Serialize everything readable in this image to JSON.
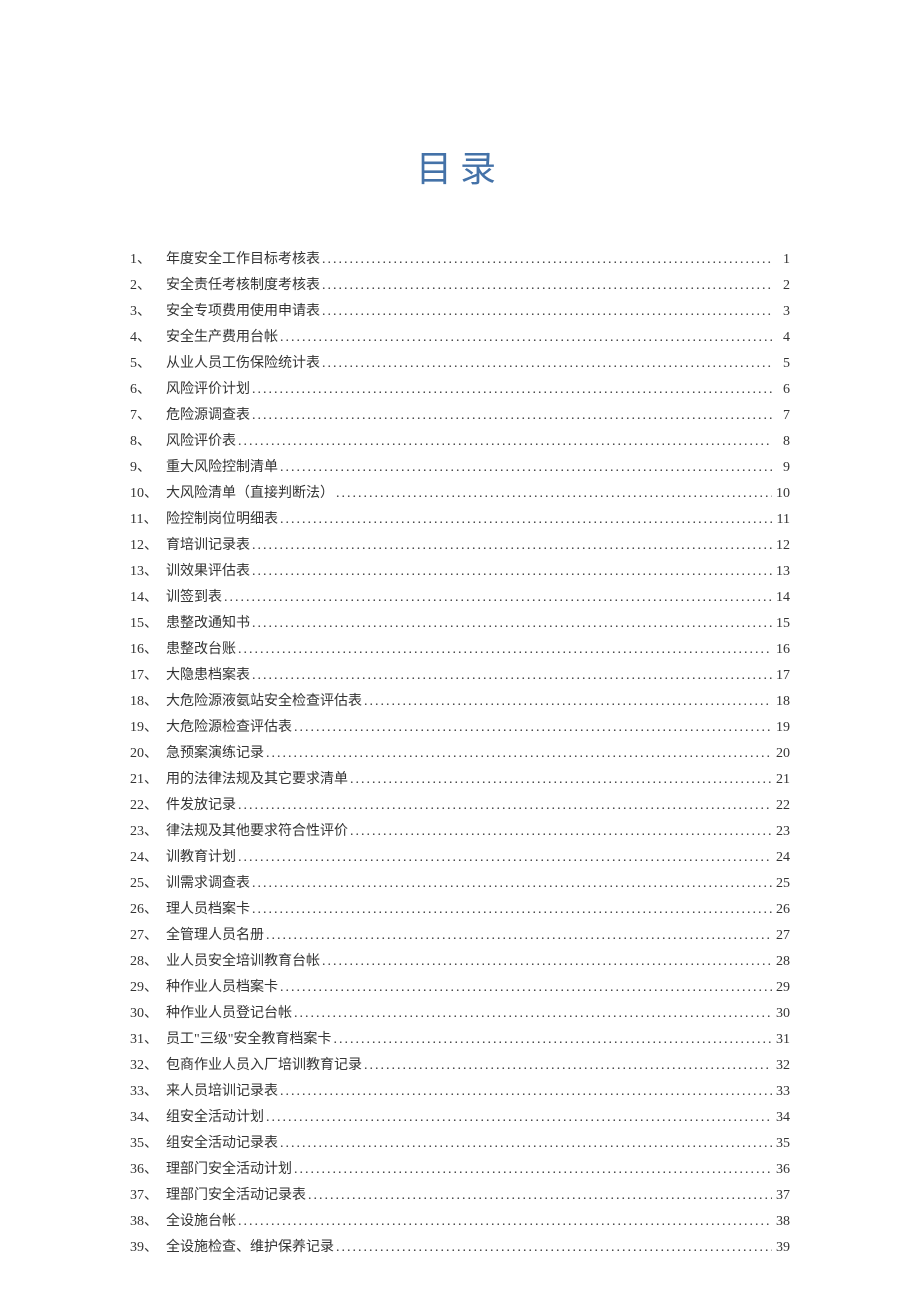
{
  "title": "目录",
  "toc": [
    {
      "num": "1、",
      "label": "年度安全工作目标考核表",
      "page": "1"
    },
    {
      "num": "2、",
      "label": "安全责任考核制度考核表",
      "page": "2"
    },
    {
      "num": "3、",
      "label": "安全专项费用使用申请表",
      "page": "3"
    },
    {
      "num": "4、",
      "label": "安全生产费用台帐",
      "page": "4"
    },
    {
      "num": "5、",
      "label": "从业人员工伤保险统计表",
      "page": "5"
    },
    {
      "num": "6、",
      "label": "风险评价计划",
      "page": "6"
    },
    {
      "num": "7、",
      "label": "危险源调查表",
      "page": "7"
    },
    {
      "num": "8、",
      "label": "风险评价表",
      "page": "8"
    },
    {
      "num": "9、",
      "label": "重大风险控制清单",
      "page": "9"
    },
    {
      "num": "10、",
      "label": "大风险清单（直接判断法）",
      "page": "10"
    },
    {
      "num": "11、",
      "label": "险控制岗位明细表",
      "page": "11"
    },
    {
      "num": "12、",
      "label": "育培训记录表",
      "page": "12"
    },
    {
      "num": "13、",
      "label": "训效果评估表",
      "page": "13"
    },
    {
      "num": "14、",
      "label": "训签到表",
      "page": "14"
    },
    {
      "num": "15、",
      "label": "患整改通知书",
      "page": "15"
    },
    {
      "num": "16、",
      "label": "患整改台账",
      "page": "16"
    },
    {
      "num": "17、",
      "label": "大隐患档案表",
      "page": "17"
    },
    {
      "num": "18、",
      "label": "大危险源液氨站安全检查评估表",
      "page": "18"
    },
    {
      "num": "19、",
      "label": "大危险源检查评估表",
      "page": "19"
    },
    {
      "num": "20、",
      "label": "急预案演练记录",
      "page": "20"
    },
    {
      "num": "21、",
      "label": "用的法律法规及其它要求清单",
      "page": "21"
    },
    {
      "num": "22、",
      "label": "件发放记录",
      "page": "22"
    },
    {
      "num": "23、",
      "label": "律法规及其他要求符合性评价",
      "page": "23"
    },
    {
      "num": "24、",
      "label": "训教育计划",
      "page": "24"
    },
    {
      "num": "25、",
      "label": "训需求调查表",
      "page": "25"
    },
    {
      "num": "26、",
      "label": "理人员档案卡",
      "page": "26"
    },
    {
      "num": "27、",
      "label": "全管理人员名册",
      "page": "27"
    },
    {
      "num": "28、",
      "label": "业人员安全培训教育台帐",
      "page": "28"
    },
    {
      "num": "29、",
      "label": "种作业人员档案卡",
      "page": "29"
    },
    {
      "num": "30、",
      "label": "种作业人员登记台帐",
      "page": "30"
    },
    {
      "num": "31、",
      "label": "员工\"三级\"安全教育档案卡",
      "page": "31"
    },
    {
      "num": "32、",
      "label": "包商作业人员入厂培训教育记录",
      "page": "32"
    },
    {
      "num": "33、",
      "label": "来人员培训记录表",
      "page": "33"
    },
    {
      "num": "34、",
      "label": "组安全活动计划",
      "page": "34"
    },
    {
      "num": "35、",
      "label": "组安全活动记录表",
      "page": "35"
    },
    {
      "num": "36、",
      "label": "理部门安全活动计划",
      "page": "36"
    },
    {
      "num": "37、",
      "label": "理部门安全活动记录表",
      "page": "37"
    },
    {
      "num": "38、",
      "label": "全设施台帐",
      "page": "38"
    },
    {
      "num": "39、",
      "label": "全设施检查、维护保养记录",
      "page": "39"
    }
  ]
}
